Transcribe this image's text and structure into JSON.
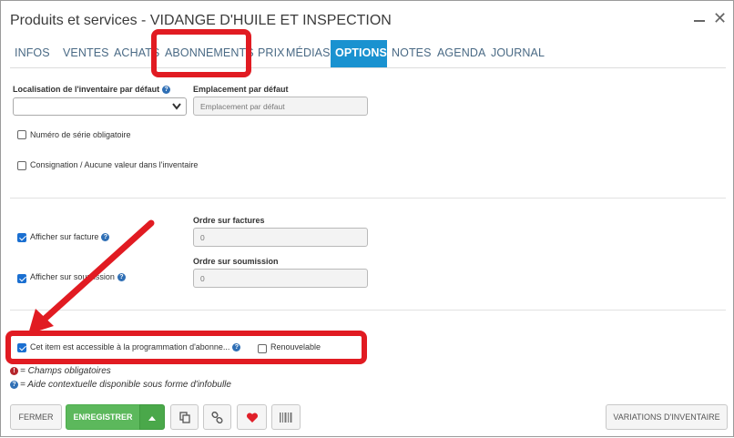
{
  "window": {
    "title": "Produits et services - VIDANGE D'HUILE ET INSPECTION",
    "close_glyph": "✕"
  },
  "tabs": [
    {
      "label": "INFOS"
    },
    {
      "label": "VENTES"
    },
    {
      "label": "ACHATS"
    },
    {
      "label": "ABONNEMENTS"
    },
    {
      "label": "PRIX"
    },
    {
      "label": "MÉDIAS"
    },
    {
      "label": "OPTIONS",
      "active": true
    },
    {
      "label": "NOTES"
    },
    {
      "label": "AGENDA"
    },
    {
      "label": "JOURNAL"
    }
  ],
  "inventory": {
    "location_label": "Localisation de l'inventaire par défaut",
    "placement_label": "Emplacement par défaut",
    "placement_placeholder": "Emplacement par défaut",
    "serial_label": "Numéro de série obligatoire",
    "consignment_label": "Consignation / Aucune valeur dans l'inventaire"
  },
  "display": {
    "show_invoice_label": "Afficher sur facture",
    "invoice_order_label": "Ordre sur factures",
    "invoice_order_value": "0",
    "show_quote_label": "Afficher sur soumission",
    "quote_order_label": "Ordre sur soumission",
    "quote_order_value": "0"
  },
  "subscription": {
    "accessible_label": "Cet item est accessible à la programmation d'abonne...",
    "renewable_label": "Renouvelable"
  },
  "legend": {
    "required_glyph": "!",
    "required_text": "= Champs obligatoires",
    "help_glyph": "?",
    "help_text": "= Aide contextuelle disponible sous forme d'infobulle"
  },
  "footer": {
    "close_label": "FERMER",
    "save_label": "ENREGISTRER",
    "variations_label": "VARIATIONS D'INVENTAIRE"
  },
  "colors": {
    "accent": "#1a92d0",
    "highlight": "#e11b22",
    "save": "#5cb85c",
    "favorite": "#e0202a"
  },
  "icons": [
    "minimize-icon",
    "close-icon",
    "help-icon",
    "chevron-down-icon",
    "copy-icon",
    "link-icon",
    "heart-icon",
    "barcode-icon",
    "caret-up-icon",
    "red-arrow-annotation"
  ]
}
